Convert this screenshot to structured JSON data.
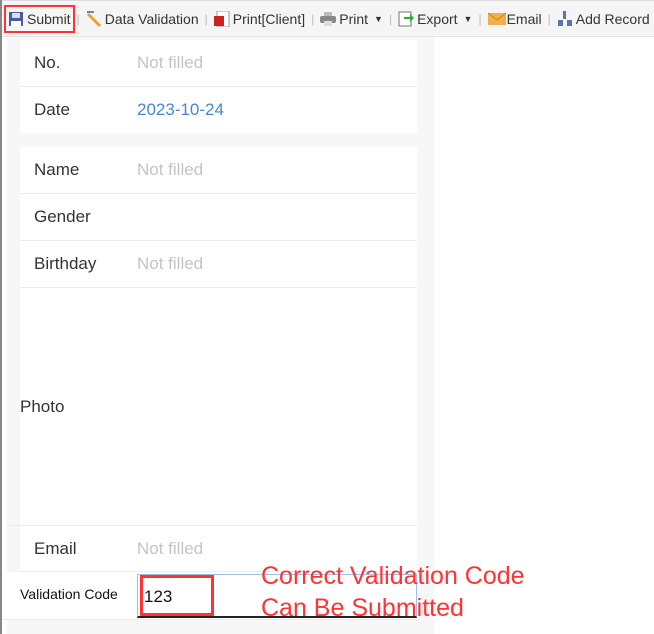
{
  "toolbar": {
    "submit": "Submit",
    "data_validation": "Data Validation",
    "print_client": "Print[Client]",
    "print": "Print",
    "export": "Export",
    "email": "Email",
    "add_record": "Add Record"
  },
  "form": {
    "no": {
      "label": "No.",
      "value": "Not filled"
    },
    "date": {
      "label": "Date",
      "value": "2023-10-24"
    },
    "name": {
      "label": "Name",
      "value": "Not filled"
    },
    "gender": {
      "label": "Gender",
      "value": ""
    },
    "birthday": {
      "label": "Birthday",
      "value": "Not filled"
    },
    "photo": {
      "label": "Photo"
    },
    "email": {
      "label": "Email",
      "value": "Not filled"
    },
    "validation_code": {
      "label": "Validation Code",
      "value": "123"
    }
  },
  "annotation": {
    "line1": "Correct Validation Code",
    "line2": "Can Be Submitted"
  },
  "colors": {
    "highlight": "#ff3333",
    "date": "#4a86d0"
  }
}
